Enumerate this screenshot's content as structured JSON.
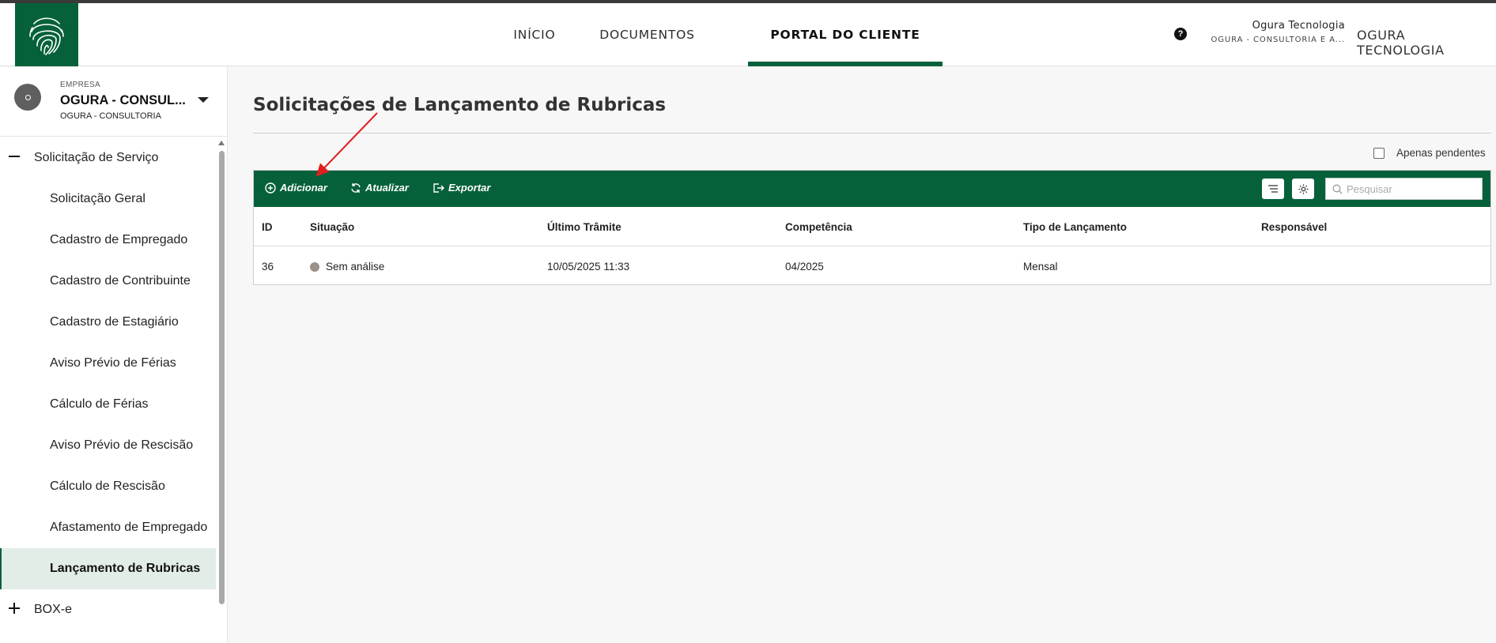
{
  "header": {
    "nav": [
      {
        "label": "INÍCIO"
      },
      {
        "label": "DOCUMENTOS"
      },
      {
        "label": "PORTAL DO CLIENTE",
        "active": true
      }
    ],
    "help_glyph": "?",
    "user_name": "Ogura Tecnologia",
    "user_company": "OGURA - CONSULTORIA E A...",
    "tenant": "OGURA TECNOLOGIA"
  },
  "sidebar": {
    "company_eyebrow": "EMPRESA",
    "company_name": "OGURA - CONSUL...",
    "company_sub": "OGURA - CONSULTORIA",
    "groups": [
      {
        "label": "Solicitação de Serviço",
        "expanded": true,
        "items": [
          "Solicitação Geral",
          "Cadastro de Empregado",
          "Cadastro de Contribuinte",
          "Cadastro de Estagiário",
          "Aviso Prévio de Férias",
          "Cálculo de Férias",
          "Aviso Prévio de Rescisão",
          "Cálculo de Rescisão",
          "Afastamento de Empregado",
          "Lançamento de Rubricas"
        ],
        "active_item": "Lançamento de Rubricas"
      },
      {
        "label": "BOX-e",
        "expanded": false
      }
    ]
  },
  "main": {
    "title": "Solicitações de Lançamento de Rubricas",
    "pending_filter_label": "Apenas pendentes",
    "pending_filter_checked": false,
    "toolbar": {
      "add_label": "Adicionar",
      "refresh_label": "Atualizar",
      "export_label": "Exportar",
      "search_placeholder": "Pesquisar"
    },
    "table": {
      "columns": [
        "ID",
        "Situação",
        "Último Trâmite",
        "Competência",
        "Tipo de Lançamento",
        "Responsável"
      ],
      "rows": [
        {
          "id": "36",
          "status": "Sem análise",
          "last_step": "10/05/2025 11:33",
          "period": "04/2025",
          "type": "Mensal",
          "owner": ""
        }
      ]
    }
  },
  "colors": {
    "brand_green": "#06613a",
    "status_gray": "#9b9086",
    "annotation_red": "#e02020"
  }
}
